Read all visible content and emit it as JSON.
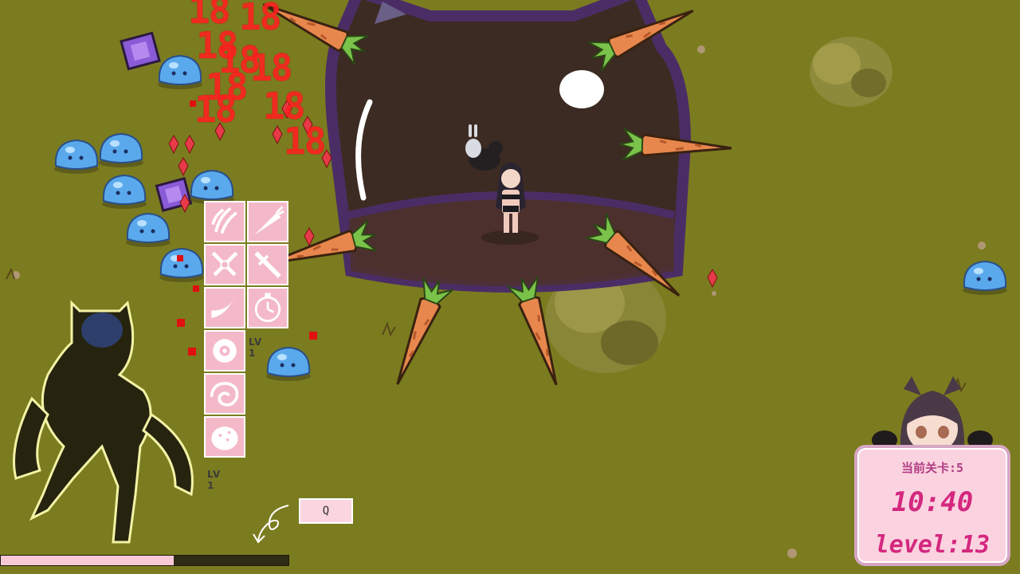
{
  "damage_numbers": [
    "18",
    "18",
    "18",
    "18",
    "18",
    "18",
    "18",
    "18",
    "18"
  ],
  "skills": {
    "col1_icons": [
      "claw-slash-icon",
      "dual-swords-icon",
      "crescent-slash-icon",
      "saw-blade-icon",
      "vortex-icon",
      "egg-icon"
    ],
    "col2_icons": [
      "carrot-icon",
      "sword-icon",
      "stopwatch-icon"
    ],
    "lv_label_1": "LV 1",
    "lv_label_2": "LV 1"
  },
  "key_hint": "Q",
  "xp_progress": 0.6,
  "status": {
    "stage_label": "当前关卡:5",
    "timer": "10:40",
    "level_text": "level:13"
  },
  "colors": {
    "grass": "#7b7c1f",
    "damage": "#ff1f1f",
    "panel_pink": "#f4b9c9",
    "accent_pink": "#d4287f"
  }
}
